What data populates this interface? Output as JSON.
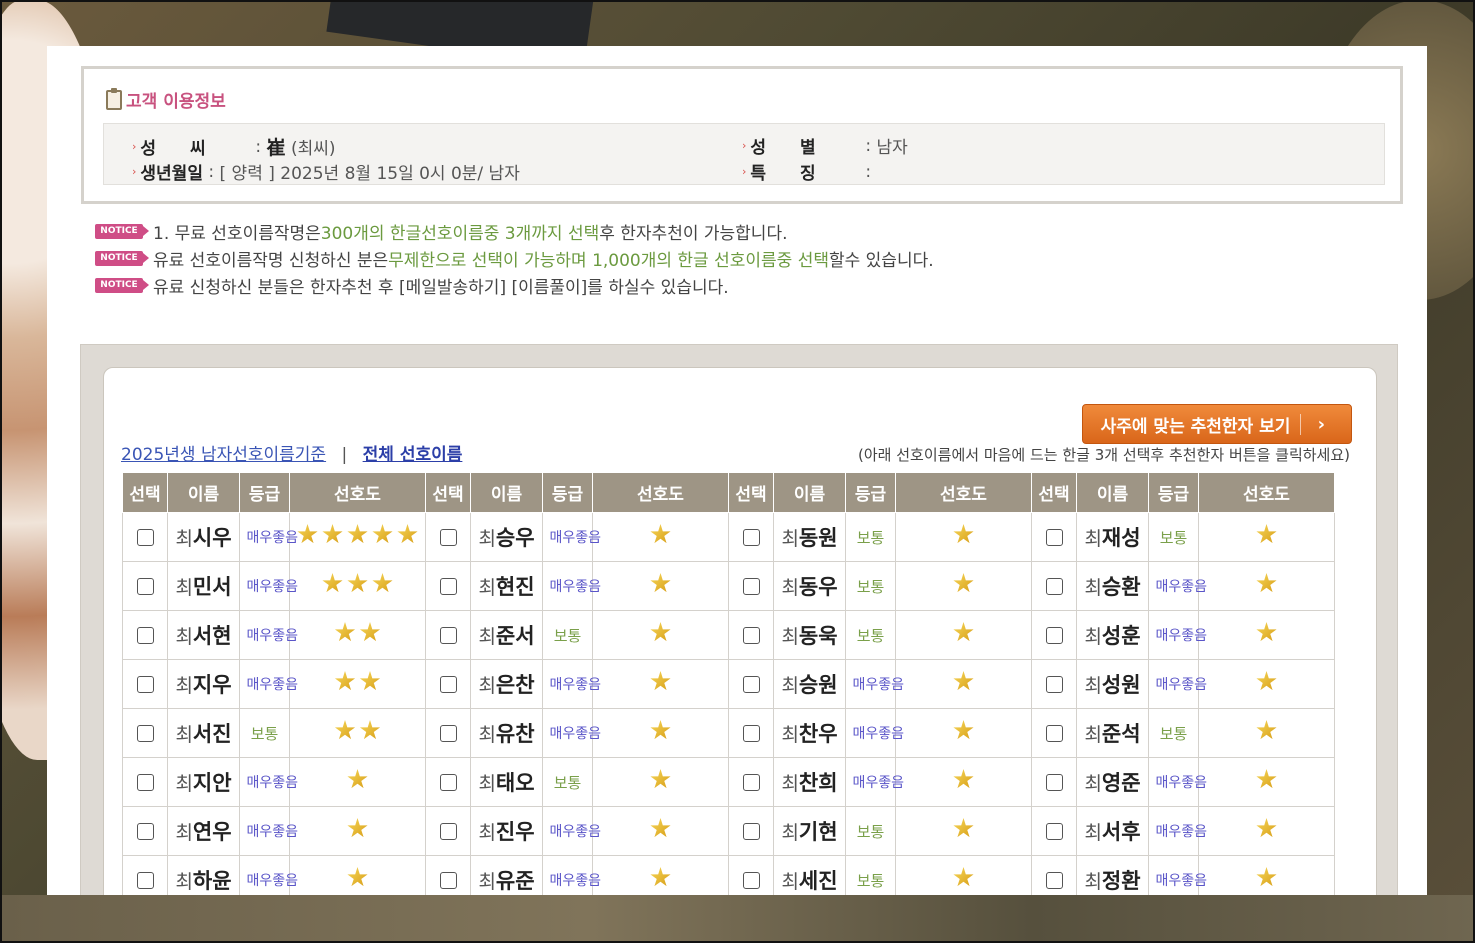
{
  "info": {
    "title": "고객 이용정보",
    "surname_label": "성　　씨",
    "surname_hanja": "崔",
    "surname_reading": "(최씨)",
    "birth_label": "생년월일",
    "birth_value": "[ 양력 ] 2025년 8월 15일 0시 0분/ 남자",
    "gender_label": "성　　별",
    "gender_value": "남자",
    "feature_label": "특　　징",
    "feature_value": ""
  },
  "notices": {
    "badge": "NOTICE",
    "n1_pre": "1. 무료 선호이름작명은 ",
    "n1_hl": "300개의 한글선호이름중 3개까지 선택",
    "n1_post": "후 한자추천이 가능합니다.",
    "n2_pre": "유료 선호이름작명 신청하신 분은",
    "n2_hl": "무제한으로 선택이 가능하며 1,000개의 한글 선호이름중 선택",
    "n2_post": "할수 있습니다.",
    "n3": "유료 신청하신 분들은 한자추천 후 [메일발송하기] [이름풀이]를 하실수 있습니다."
  },
  "panel": {
    "recommend_button": "사주에 맞는 추천한자 보기",
    "link_basis": "2025년생 남자선호이름기준",
    "separator": "|",
    "link_all": "전체 선호이름",
    "hint": "(아래 선호이름에서 마음에 드는 한글 3개 선택후 추천한자 버튼을 클릭하세요)"
  },
  "table": {
    "headers": {
      "select": "선택",
      "name": "이름",
      "grade": "등급",
      "pref": "선호도"
    },
    "surname": "최",
    "grade_good": "매우좋음",
    "grade_normal": "보통",
    "rows": [
      [
        {
          "given": "시우",
          "grade": "매우좋음",
          "stars": 5
        },
        {
          "given": "승우",
          "grade": "매우좋음",
          "stars": 1
        },
        {
          "given": "동원",
          "grade": "보통",
          "stars": 1
        },
        {
          "given": "재성",
          "grade": "보통",
          "stars": 1
        }
      ],
      [
        {
          "given": "민서",
          "grade": "매우좋음",
          "stars": 3
        },
        {
          "given": "현진",
          "grade": "매우좋음",
          "stars": 1
        },
        {
          "given": "동우",
          "grade": "보통",
          "stars": 1
        },
        {
          "given": "승환",
          "grade": "매우좋음",
          "stars": 1
        }
      ],
      [
        {
          "given": "서현",
          "grade": "매우좋음",
          "stars": 2
        },
        {
          "given": "준서",
          "grade": "보통",
          "stars": 1
        },
        {
          "given": "동욱",
          "grade": "보통",
          "stars": 1
        },
        {
          "given": "성훈",
          "grade": "매우좋음",
          "stars": 1
        }
      ],
      [
        {
          "given": "지우",
          "grade": "매우좋음",
          "stars": 2
        },
        {
          "given": "은찬",
          "grade": "매우좋음",
          "stars": 1
        },
        {
          "given": "승원",
          "grade": "매우좋음",
          "stars": 1
        },
        {
          "given": "성원",
          "grade": "매우좋음",
          "stars": 1
        }
      ],
      [
        {
          "given": "서진",
          "grade": "보통",
          "stars": 2
        },
        {
          "given": "유찬",
          "grade": "매우좋음",
          "stars": 1
        },
        {
          "given": "찬우",
          "grade": "매우좋음",
          "stars": 1
        },
        {
          "given": "준석",
          "grade": "보통",
          "stars": 1
        }
      ],
      [
        {
          "given": "지안",
          "grade": "매우좋음",
          "stars": 1
        },
        {
          "given": "태오",
          "grade": "보통",
          "stars": 1
        },
        {
          "given": "찬희",
          "grade": "매우좋음",
          "stars": 1
        },
        {
          "given": "영준",
          "grade": "매우좋음",
          "stars": 1
        }
      ],
      [
        {
          "given": "연우",
          "grade": "매우좋음",
          "stars": 1
        },
        {
          "given": "진우",
          "grade": "매우좋음",
          "stars": 1
        },
        {
          "given": "기현",
          "grade": "보통",
          "stars": 1
        },
        {
          "given": "서후",
          "grade": "매우좋음",
          "stars": 1
        }
      ],
      [
        {
          "given": "하윤",
          "grade": "매우좋음",
          "stars": 1
        },
        {
          "given": "유준",
          "grade": "매우좋음",
          "stars": 1
        },
        {
          "given": "세진",
          "grade": "보통",
          "stars": 1
        },
        {
          "given": "정환",
          "grade": "매우좋음",
          "stars": 1
        }
      ]
    ]
  },
  "colors": {
    "header_bg": "#9e9585",
    "grade_good": "#5a55c8",
    "grade_normal": "#7aa04a",
    "title_pink": "#c8527f",
    "button_orange": "#e57a2b"
  }
}
